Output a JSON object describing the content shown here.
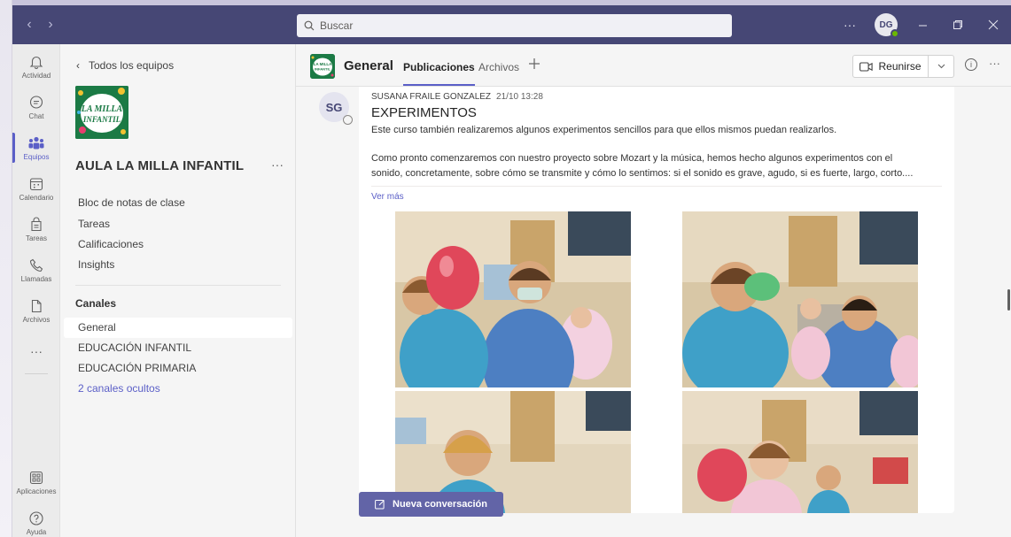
{
  "titlebar": {
    "search_placeholder": "Buscar",
    "more_label": "···",
    "avatar_initials": "DG"
  },
  "rail": [
    {
      "name": "rail-actividad",
      "icon": "bell-icon",
      "label": "Actividad",
      "active": false
    },
    {
      "name": "rail-chat",
      "icon": "chat-icon",
      "label": "Chat",
      "active": false
    },
    {
      "name": "rail-equipos",
      "icon": "teams-icon",
      "label": "Equipos",
      "active": true
    },
    {
      "name": "rail-calendario",
      "icon": "calendar-icon",
      "label": "Calendario",
      "active": false
    },
    {
      "name": "rail-tareas",
      "icon": "assignments-icon",
      "label": "Tareas",
      "active": false
    },
    {
      "name": "rail-llamadas",
      "icon": "phone-icon",
      "label": "Llamadas",
      "active": false
    },
    {
      "name": "rail-archivos",
      "icon": "file-icon",
      "label": "Archivos",
      "active": false
    }
  ],
  "rail_more": "···",
  "rail_bottom": {
    "apps_label": "Aplicaciones",
    "help_label": "Ayuda"
  },
  "teampane": {
    "back_label": "Todos los equipos",
    "team_logo_text": "LA MILLA INFANTIL",
    "team_name": "AULA LA MILLA INFANTIL",
    "team_more": "···",
    "menu": [
      "Bloc de notas de clase",
      "Tareas",
      "Calificaciones",
      "Insights"
    ],
    "channels_heading": "Canales",
    "channels": [
      "General",
      "EDUCACIÓN INFANTIL",
      "EDUCACIÓN PRIMARIA"
    ],
    "hidden_channels": "2 canales ocultos"
  },
  "channel_header": {
    "title": "General",
    "tabs": [
      "Publicaciones",
      "Archivos"
    ],
    "meet_label": "Reunirse",
    "more": "···",
    "logo_text": "LA MILLA INFANTIL"
  },
  "post": {
    "avatar_initials": "SG",
    "author": "SUSANA FRAILE GONZALEZ",
    "time": "21/10 13:28",
    "title": "EXPERIMENTOS",
    "para1": "Este curso también realizaremos algunos experimentos sencillos para que ellos mismos puedan realizarlos.",
    "para2_line1": "Como pronto comenzaremos con nuestro proyecto sobre Mozart y la música, hemos hecho algunos experimentos con el",
    "para2_line2": "sonido, concretamente, sobre cómo se transmite y cómo lo sentimos: si el sonido es grave, agudo, si es fuerte, largo, corto....",
    "see_more": "Ver más"
  },
  "new_conversation_label": "Nueva conversación",
  "colors": {
    "titlebar": "#464775",
    "accent": "#5b5fc7",
    "button": "#6264a7"
  }
}
